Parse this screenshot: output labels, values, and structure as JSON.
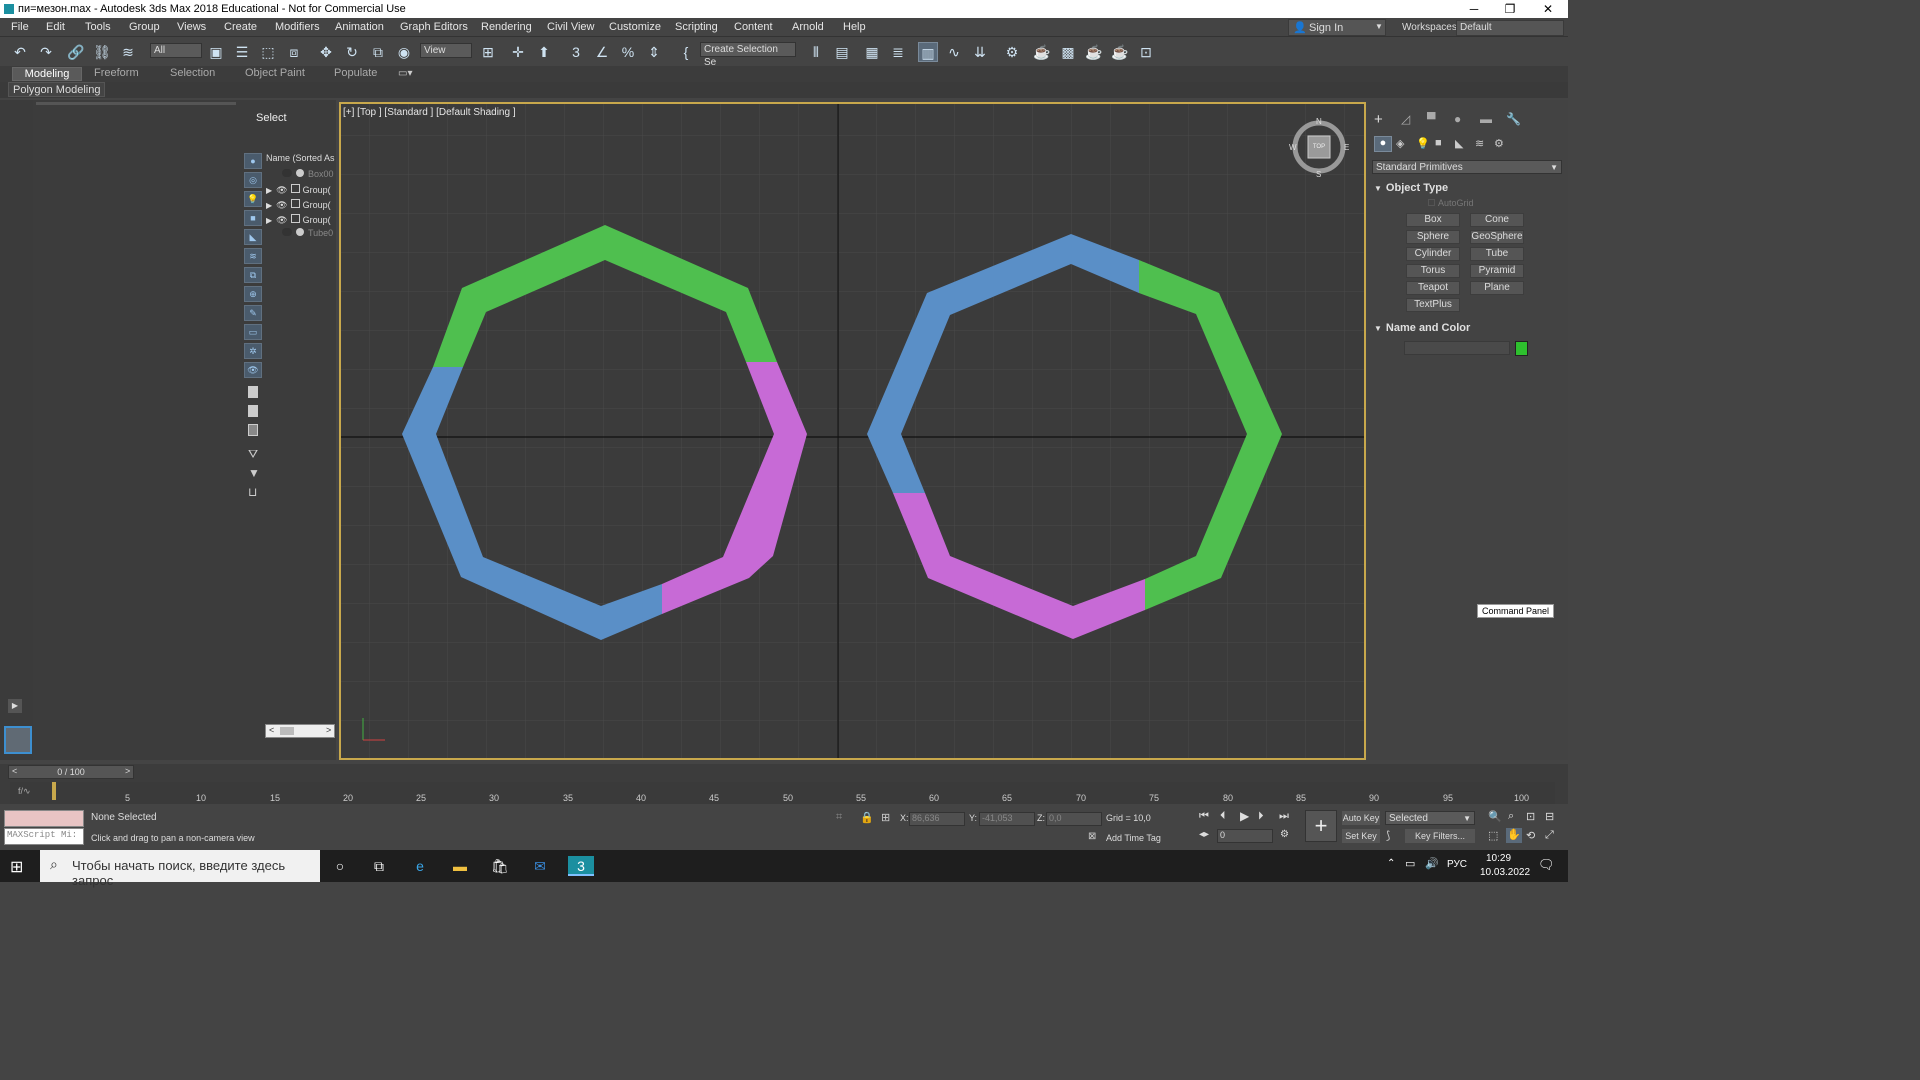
{
  "window": {
    "title": "пи=мезон.max - Autodesk 3ds Max 2018 Educational - Not for Commercial Use"
  },
  "menu": [
    "File",
    "Edit",
    "Tools",
    "Group",
    "Views",
    "Create",
    "Modifiers",
    "Animation",
    "Graph Editors",
    "Rendering",
    "Civil View",
    "Customize",
    "Scripting",
    "Content",
    "Arnold",
    "Help"
  ],
  "account": {
    "sign_in": "Sign In",
    "workspaces_label": "Workspaces:",
    "workspace": "Default"
  },
  "toolbar": {
    "filter": "All",
    "ref_coord": "View",
    "selection_set": "Create Selection Se"
  },
  "ribbon": {
    "tabs": [
      "Modeling",
      "Freeform",
      "Selection",
      "Object Paint",
      "Populate"
    ],
    "panel": "Polygon Modeling"
  },
  "explorer": {
    "select_label": "Select",
    "column": "Name (Sorted As",
    "rows": [
      "Box00",
      "Group(",
      "Group(",
      "Group(",
      "Tube0"
    ]
  },
  "viewport": {
    "label": "[+] [Top ] [Standard ] [Default Shading ]",
    "viewcube": {
      "n": "N",
      "s": "S",
      "e": "E",
      "w": "W",
      "face": "TOP"
    }
  },
  "command_panel": {
    "category": "Standard Primitives",
    "object_type": "Object Type",
    "autogrid": "AutoGrid",
    "buttons": [
      "Box",
      "Cone",
      "Sphere",
      "GeoSphere",
      "Cylinder",
      "Tube",
      "Torus",
      "Pyramid",
      "Teapot",
      "Plane",
      "TextPlus"
    ],
    "name_and_color": "Name and Color",
    "tooltip": "Command Panel",
    "color": "#2ec02e"
  },
  "timeline": {
    "frame": "0 / 100",
    "ticks": [
      "5",
      "10",
      "15",
      "20",
      "25",
      "30",
      "35",
      "40",
      "45",
      "50",
      "55",
      "60",
      "65",
      "70",
      "75",
      "80",
      "85",
      "90",
      "95",
      "100"
    ]
  },
  "status": {
    "selection": "None Selected",
    "prompt": "Click and drag to pan a non-camera view",
    "maxscript": "MAXScript Mi:",
    "x_label": "X:",
    "x": "86,636",
    "y_label": "Y:",
    "y": "-41,053",
    "z_label": "Z:",
    "z": "0,0",
    "grid": "Grid = 10,0",
    "add_time_tag": "Add Time Tag",
    "auto_key": "Auto Key",
    "set_key": "Set Key",
    "selected": "Selected",
    "key_filters": "Key Filters...",
    "frame_value": "0"
  },
  "taskbar": {
    "search": "Чтобы начать поиск, введите здесь запрос",
    "lang": "РУС",
    "time": "10:29",
    "date": "10.03.2022"
  },
  "colors": {
    "green": "#4fbf4f",
    "blue": "#5a8fc7",
    "magenta": "#c76ad6",
    "viewport_border": "#c8a84c"
  }
}
